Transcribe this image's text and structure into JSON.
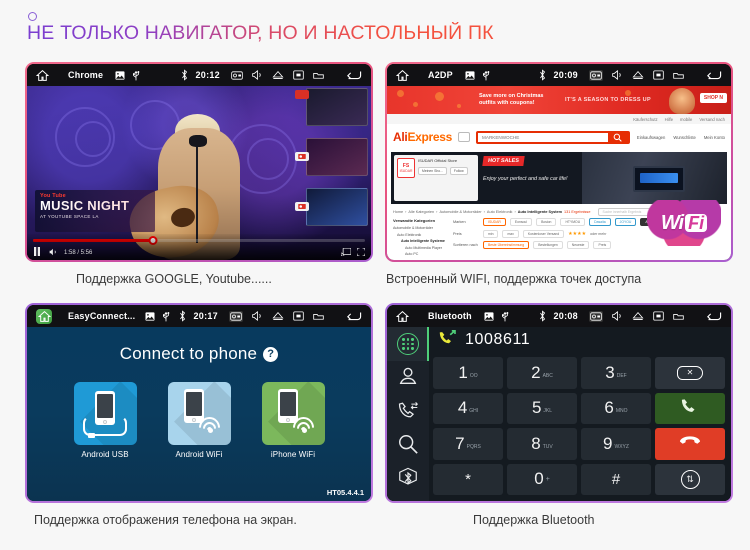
{
  "header": {
    "title": "НЕ ТОЛЬКО НАВИГАТОР, НО И НАСТОЛЬНЫЙ ПК",
    "accent_purple": "#7a3ed0",
    "accent_red": "#f4513e"
  },
  "panels": {
    "youtube": {
      "statusbar": {
        "app": "Chrome",
        "time": "20:12",
        "icons": [
          "home-icon",
          "gallery-icon",
          "usb-icon",
          "bluetooth-icon",
          "camera-icon",
          "volume-icon",
          "eject-icon",
          "screen-icon",
          "folder-icon",
          "back-icon"
        ]
      },
      "overlay": {
        "logo": "You Tube",
        "title": "MUSIC NIGHT",
        "subtitle": "AT YOUTUBE SPACE LA"
      },
      "player": {
        "time": "1:58 / 5:56",
        "progress_percent": 36
      },
      "caption": "Поддержка GOOGLE, Youtube......"
    },
    "aliexpress": {
      "statusbar": {
        "app": "A2DP",
        "time": "20:09"
      },
      "banner": {
        "left_text": "Save more on Christmas outfits with coupons!",
        "right_text": "IT'S A SEASON TO DRESS UP",
        "shop_button": "SHOP N"
      },
      "toprow": [
        "Käuferschutz",
        "Hilfe",
        "mobile",
        "Versand nach"
      ],
      "logo": {
        "ali": "Ali",
        "express": "Express",
        "mark": "®"
      },
      "search": {
        "placeholder": "MARKENWOCHE",
        "button_icon": "search-icon"
      },
      "nav_icons": [
        "Einkaufswagen",
        "Wunschliste",
        "Mein Konto"
      ],
      "hero": {
        "store_logo_top": "FS",
        "store_logo_bottom": "ISUDAR",
        "store_name": "ISUDAR Official Store",
        "btn1": "Meinen Sho...",
        "btn2": "Follow",
        "hot_label": "HOT SALES",
        "tagline": "Enjoy your perfect and safe car life!"
      },
      "breadcrumbs": [
        "Home",
        "Alle Kategorien",
        "Automobile & Motorräder",
        "Auto Elektronik",
        "Auto Intelligente System",
        "131 Ergebnisse"
      ],
      "breadcrumb_search_placeholder": "Suche innerhalb Ergebnis",
      "sidebar": {
        "heading": "Verwandte Kategorien",
        "items": [
          "Automobile & Motorräder",
          "Auto Elektronik",
          "Auto Intelligente Systeme",
          "Auto Multimedia Player",
          "Auto PC"
        ]
      },
      "filters": {
        "brand_label": "Marken",
        "price_label": "Preis",
        "sort_label": "Sortieren nach",
        "brands": [
          "ISUDAR",
          "Eonsoul",
          "Bosion",
          "HTYMOU",
          "Dasaita",
          "JOYOU",
          "AUDIOSOUCES",
          "RXWX",
          "Ownice",
          "Google"
        ],
        "price_min": "min",
        "price_max": "max",
        "free_shipping": "Kostenloser Versand",
        "rating": "oder mehr",
        "sorts": [
          "Beste Übereinstimmung",
          "Bestellungen",
          "Neueste",
          "Preis"
        ]
      },
      "wifi_badge": {
        "wi": "Wi",
        "fi": "Fi"
      },
      "caption": "Встроенный WIFI, поддержка точек доступа"
    },
    "easyconnect": {
      "statusbar": {
        "app": "EasyConnect...",
        "time": "20:17"
      },
      "title": "Connect to phone",
      "help_icon": "?",
      "tiles": [
        {
          "label": "Android USB",
          "color": "#1f9ad6",
          "icon": "phone-usb-icon"
        },
        {
          "label": "Android WiFi",
          "color": "#a8d4ec",
          "icon": "phone-wifi-icon"
        },
        {
          "label": "iPhone WiFi",
          "color": "#7cb85c",
          "icon": "iphone-wifi-icon"
        }
      ],
      "version": "HT05.4.4.1",
      "caption": "Поддержка отображения телефона на экран."
    },
    "bluetooth": {
      "statusbar": {
        "app": "Bluetooth",
        "time": "20:08"
      },
      "dialed_number": "1008611",
      "call_icon": "outgoing-call-icon",
      "sidebar_icons": [
        "keypad-icon",
        "contacts-icon",
        "call-history-icon",
        "search-icon",
        "bluetooth-icon"
      ],
      "keys": [
        {
          "digit": "1",
          "sub": "OO"
        },
        {
          "digit": "2",
          "sub": "ABC"
        },
        {
          "digit": "3",
          "sub": "DEF"
        },
        {
          "digit": "4",
          "sub": "GHI"
        },
        {
          "digit": "5",
          "sub": "JKL"
        },
        {
          "digit": "6",
          "sub": "MNO"
        },
        {
          "digit": "7",
          "sub": "PQRS"
        },
        {
          "digit": "8",
          "sub": "TUV"
        },
        {
          "digit": "9",
          "sub": "WXYZ"
        },
        {
          "digit": "*",
          "sub": ""
        },
        {
          "digit": "0",
          "sub": "+"
        },
        {
          "digit": "#",
          "sub": ""
        }
      ],
      "action_keys": {
        "delete": "delete-icon",
        "call": "call-icon",
        "hangup": "hangup-icon",
        "transfer": "transfer-icon"
      },
      "colors": {
        "call_green": "#2f5b22",
        "hangup_red": "#e03d26",
        "accent_green": "#4fd07a"
      },
      "caption": "Поддержка Bluetooth"
    }
  }
}
